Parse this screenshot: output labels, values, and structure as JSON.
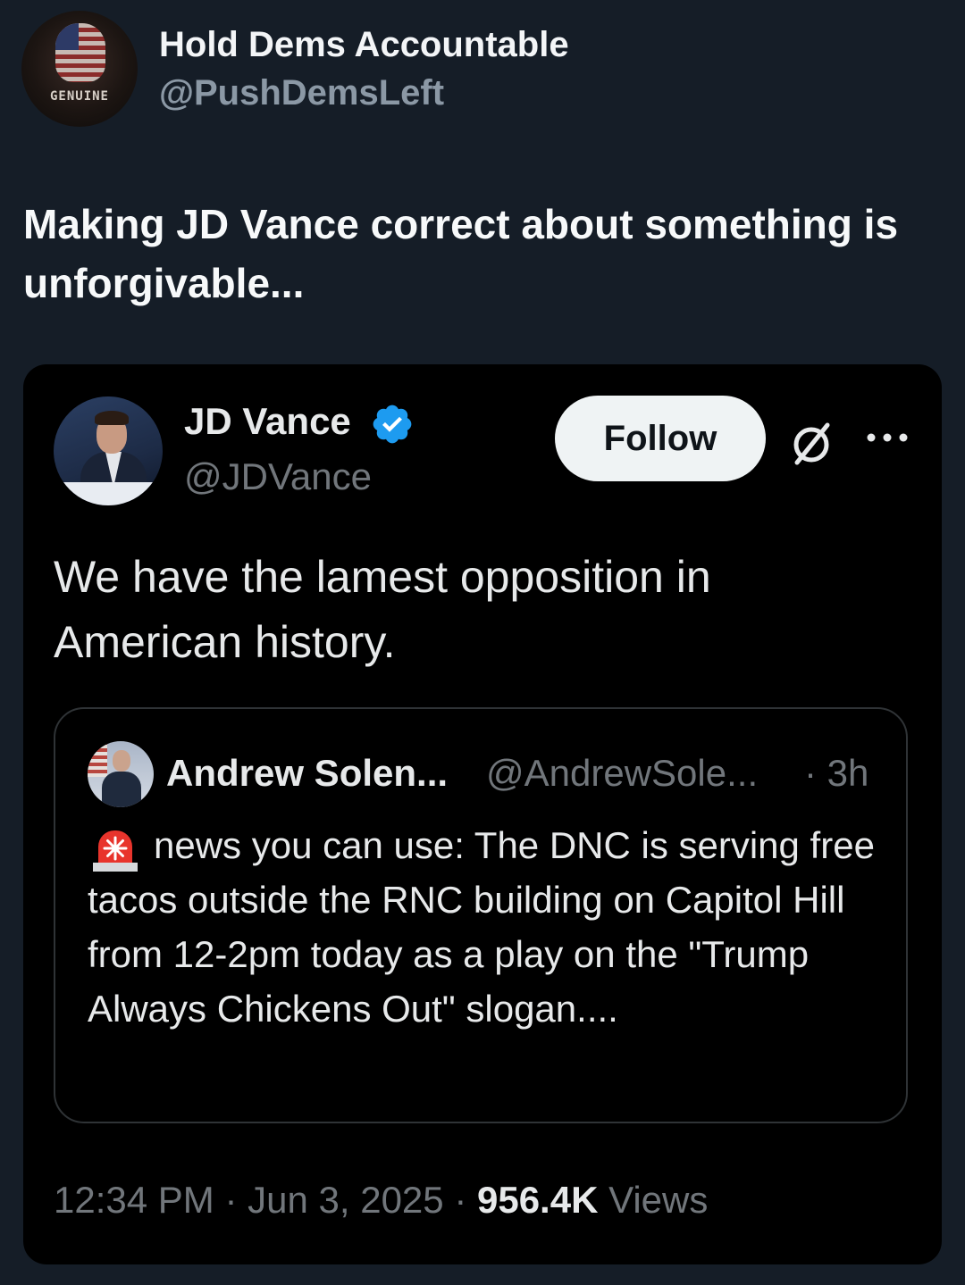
{
  "outer_post": {
    "author_name": "Hold Dems Accountable",
    "author_handle": "@PushDemsLeft",
    "avatar_text": "GENUINE",
    "text": "Making JD Vance correct about something is unforgivable..."
  },
  "embedded_post": {
    "author_name": "JD Vance",
    "author_handle": "@JDVance",
    "verified": true,
    "follow_label": "Follow",
    "text": "We have the lamest opposition in American history.",
    "quoted": {
      "author_name": "Andrew Solen...",
      "author_handle": "@AndrewSole...",
      "time": "· 3h",
      "icon": "siren-emoji",
      "text": "news you can use: The DNC is serving free tacos outside the RNC building on Capitol Hill from 12-2pm today as a play on the \"Trump Always Chickens Out\" slogan...."
    },
    "time": "12:34 PM",
    "date": "Jun 3, 2025",
    "views_count": "956.4K",
    "views_label": "Views",
    "separator": "·"
  },
  "colors": {
    "page_background": "#151d27",
    "card_background": "#000000",
    "verified_blue": "#1d9bf0",
    "muted_text": "#71767b",
    "follow_button": "#eff3f4"
  },
  "icons": [
    "verified-badge-icon",
    "grok-icon",
    "more-options-icon",
    "siren-icon"
  ]
}
